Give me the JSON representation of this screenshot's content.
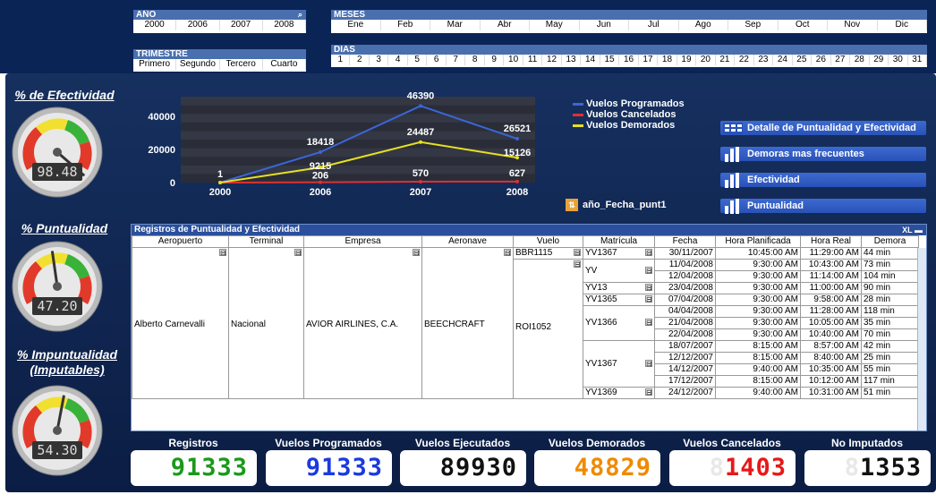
{
  "filters": {
    "ano": {
      "label": "AÑO",
      "items": [
        "2000",
        "2006",
        "2007",
        "2008"
      ]
    },
    "trimestre": {
      "label": "TRIMESTRE",
      "items": [
        "Primero",
        "Segundo",
        "Tercero",
        "Cuarto"
      ]
    },
    "meses": {
      "label": "MESES",
      "items": [
        "Ene",
        "Feb",
        "Mar",
        "Abr",
        "May",
        "Jun",
        "Jul",
        "Ago",
        "Sep",
        "Oct",
        "Nov",
        "Dic"
      ]
    },
    "dias": {
      "label": "DIAS",
      "items": [
        "1",
        "2",
        "3",
        "4",
        "5",
        "6",
        "7",
        "8",
        "9",
        "10",
        "11",
        "12",
        "13",
        "14",
        "15",
        "16",
        "17",
        "18",
        "19",
        "20",
        "21",
        "22",
        "23",
        "24",
        "25",
        "26",
        "27",
        "28",
        "29",
        "30",
        "31"
      ]
    }
  },
  "gauges": [
    {
      "title": "% de Efectividad",
      "value": "98.48"
    },
    {
      "title": "% Puntualidad",
      "value": "47.20"
    },
    {
      "title": "% Impuntualidad (Imputables)",
      "value": "54.30"
    }
  ],
  "chart_data": {
    "type": "line",
    "categories": [
      "2000",
      "2006",
      "2007",
      "2008"
    ],
    "series": [
      {
        "name": "Vuelos Programados",
        "values": [
          1,
          18418,
          46390,
          26521
        ],
        "color": "#3a66d8"
      },
      {
        "name": "Vuelos Cancelados",
        "values": [
          0,
          206,
          570,
          627
        ],
        "color": "#e03030"
      },
      {
        "name": "Vuelos Demorados",
        "values": [
          0,
          9215,
          24487,
          15126
        ],
        "color": "#e6e020"
      }
    ],
    "yticks": [
      "0",
      "20000",
      "40000"
    ],
    "ylim": [
      0,
      52000
    ],
    "data_labels": [
      {
        "text": "1",
        "cat": 0,
        "v": 1
      },
      {
        "text": "18418",
        "cat": 1,
        "v": 18418
      },
      {
        "text": "9215",
        "cat": 1,
        "v": 9215
      },
      {
        "text": "206",
        "cat": 1,
        "v": 206
      },
      {
        "text": "46390",
        "cat": 2,
        "v": 46390
      },
      {
        "text": "24487",
        "cat": 2,
        "v": 24487
      },
      {
        "text": "570",
        "cat": 2,
        "v": 570
      },
      {
        "text": "26521",
        "cat": 3,
        "v": 26521
      },
      {
        "text": "15126",
        "cat": 3,
        "v": 15126
      },
      {
        "text": "627",
        "cat": 3,
        "v": 627
      }
    ]
  },
  "dimension_label": "año_Fecha_punt1",
  "nav_buttons": [
    "Detalle de Puntualidad y Efectividad",
    "Demoras mas frecuentes",
    "Efectividad",
    "Puntualidad"
  ],
  "table": {
    "title": "Registros de Puntualidad y Efectividad",
    "tools": "XL",
    "columns": [
      "Aeropuerto",
      "Terminal",
      "Empresa",
      "Aeronave",
      "Vuelo",
      "Matrícula",
      "Fecha",
      "Hora Planificada",
      "Hora Real",
      "Demora"
    ],
    "aeropuerto": "Alberto Carnevalli",
    "terminal": "Nacional",
    "empresa": "AVIOR AIRLINES, C.A.",
    "aeronave": "BEECHCRAFT",
    "vuelos": [
      "BBR1115",
      "ROI1052"
    ],
    "matriculas": [
      "YV1367",
      "YV",
      "YV13",
      "YV1365",
      "YV1366",
      "YV1367",
      "YV1369"
    ],
    "rows": [
      [
        "30/11/2007",
        "10:45:00 AM",
        "11:29:00 AM",
        "44 min"
      ],
      [
        "11/04/2008",
        "9:30:00 AM",
        "10:43:00 AM",
        "73 min"
      ],
      [
        "12/04/2008",
        "9:30:00 AM",
        "11:14:00 AM",
        "104 min"
      ],
      [
        "23/04/2008",
        "9:30:00 AM",
        "11:00:00 AM",
        "90 min"
      ],
      [
        "07/04/2008",
        "9:30:00 AM",
        "9:58:00 AM",
        "28 min"
      ],
      [
        "04/04/2008",
        "9:30:00 AM",
        "11:28:00 AM",
        "118 min"
      ],
      [
        "21/04/2008",
        "9:30:00 AM",
        "10:05:00 AM",
        "35 min"
      ],
      [
        "22/04/2008",
        "9:30:00 AM",
        "10:40:00 AM",
        "70 min"
      ],
      [
        "18/07/2007",
        "8:15:00 AM",
        "8:57:00 AM",
        "42 min"
      ],
      [
        "12/12/2007",
        "8:15:00 AM",
        "8:40:00 AM",
        "25 min"
      ],
      [
        "14/12/2007",
        "9:40:00 AM",
        "10:35:00 AM",
        "55 min"
      ],
      [
        "17/12/2007",
        "8:15:00 AM",
        "10:12:00 AM",
        "117 min"
      ],
      [
        "24/12/2007",
        "9:40:00 AM",
        "10:31:00 AM",
        "51 min"
      ]
    ]
  },
  "kpis": [
    {
      "title": "Registros",
      "value": "91333",
      "color": "#1a9a1a"
    },
    {
      "title": "Vuelos Programados",
      "value": "91333",
      "color": "#1a3adf"
    },
    {
      "title": "Vuelos Ejecutados",
      "value": "89930",
      "color": "#111111"
    },
    {
      "title": "Vuelos Demorados",
      "value": "48829",
      "color": "#f08a00"
    },
    {
      "title": "Vuelos Cancelados",
      "value": "1403",
      "color": "#e81818"
    },
    {
      "title": "No Imputados",
      "value": "1353",
      "color": "#111111"
    }
  ]
}
